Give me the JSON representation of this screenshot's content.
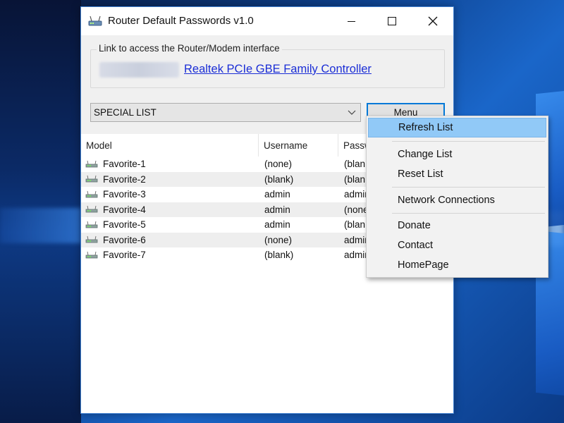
{
  "window": {
    "title": "Router Default Passwords v1.0"
  },
  "link_group": {
    "legend": "Link to access the Router/Modem interface",
    "link_text": "Realtek PCIe GBE Family Controller"
  },
  "combo": {
    "selected": "SPECIAL LIST"
  },
  "menu_button": {
    "label": "Menu"
  },
  "list": {
    "columns": [
      "Model",
      "Username",
      "Passw"
    ],
    "rows": [
      {
        "model": "Favorite-1",
        "username": "(none)",
        "password": "(blan"
      },
      {
        "model": "Favorite-2",
        "username": "(blank)",
        "password": "(blan"
      },
      {
        "model": "Favorite-3",
        "username": "admin",
        "password": "admin"
      },
      {
        "model": "Favorite-4",
        "username": "admin",
        "password": "(none"
      },
      {
        "model": "Favorite-5",
        "username": "admin",
        "password": "(blan"
      },
      {
        "model": "Favorite-6",
        "username": "(none)",
        "password": "admin"
      },
      {
        "model": "Favorite-7",
        "username": "(blank)",
        "password": "admin"
      }
    ]
  },
  "context_menu": {
    "items": [
      "Refresh List",
      "Change List",
      "Reset List",
      "Network Connections",
      "Donate",
      "Contact",
      "HomePage"
    ],
    "highlighted": "Refresh List"
  },
  "colors": {
    "link": "#1b2ed6",
    "highlight": "#91c9f7",
    "focus_border": "#0078d7"
  },
  "icons": {
    "app": "router-icon",
    "row": "network-device-icon",
    "combo_arrow": "chevron-down-icon"
  }
}
